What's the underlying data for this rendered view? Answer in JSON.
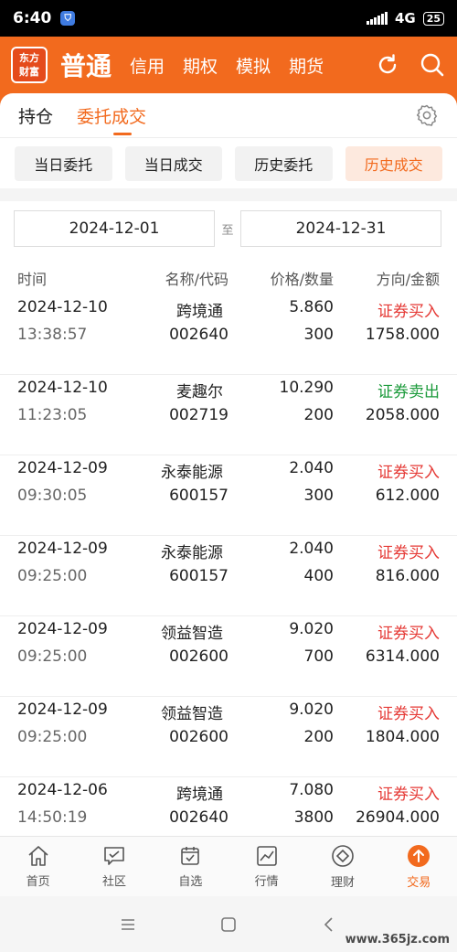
{
  "status_bar": {
    "time": "6:40",
    "network": "4G",
    "battery": "25"
  },
  "header": {
    "logo_line1": "东方",
    "logo_line2": "财富",
    "title": "普通",
    "nav": [
      "信用",
      "期权",
      "模拟",
      "期货"
    ],
    "icons": [
      "refresh-icon",
      "search-icon"
    ]
  },
  "tabs": {
    "holdings": "持仓",
    "orders": "委托成交"
  },
  "segments": [
    "当日委托",
    "当日成交",
    "历史委托",
    "历史成交"
  ],
  "date_range": {
    "start": "2024-12-01",
    "separator": "至",
    "end": "2024-12-31"
  },
  "table_header": {
    "time": "时间",
    "name_code": "名称/代码",
    "price_qty": "价格/数量",
    "dir_amount": "方向/金额"
  },
  "rows": [
    {
      "date": "2024-12-10",
      "time": "13:38:57",
      "name": "跨境通",
      "code": "002640",
      "price": "5.860",
      "qty": "300",
      "direction": "证券买入",
      "amount": "1758.000",
      "side": "buy"
    },
    {
      "date": "2024-12-10",
      "time": "11:23:05",
      "name": "麦趣尔",
      "code": "002719",
      "price": "10.290",
      "qty": "200",
      "direction": "证券卖出",
      "amount": "2058.000",
      "side": "sell"
    },
    {
      "date": "2024-12-09",
      "time": "09:30:05",
      "name": "永泰能源",
      "code": "600157",
      "price": "2.040",
      "qty": "300",
      "direction": "证券买入",
      "amount": "612.000",
      "side": "buy"
    },
    {
      "date": "2024-12-09",
      "time": "09:25:00",
      "name": "永泰能源",
      "code": "600157",
      "price": "2.040",
      "qty": "400",
      "direction": "证券买入",
      "amount": "816.000",
      "side": "buy"
    },
    {
      "date": "2024-12-09",
      "time": "09:25:00",
      "name": "领益智造",
      "code": "002600",
      "price": "9.020",
      "qty": "700",
      "direction": "证券买入",
      "amount": "6314.000",
      "side": "buy"
    },
    {
      "date": "2024-12-09",
      "time": "09:25:00",
      "name": "领益智造",
      "code": "002600",
      "price": "9.020",
      "qty": "200",
      "direction": "证券买入",
      "amount": "1804.000",
      "side": "buy"
    },
    {
      "date": "2024-12-06",
      "time": "14:50:19",
      "name": "跨境通",
      "code": "002640",
      "price": "7.080",
      "qty": "3800",
      "direction": "证券买入",
      "amount": "26904.000",
      "side": "buy"
    }
  ],
  "bottom_nav": [
    "首页",
    "社区",
    "自选",
    "行情",
    "理财",
    "交易"
  ],
  "watermark": "www.365jz.com",
  "colors": {
    "brand": "#f26a1e",
    "buy": "#e53935",
    "sell": "#1a9a3a"
  }
}
